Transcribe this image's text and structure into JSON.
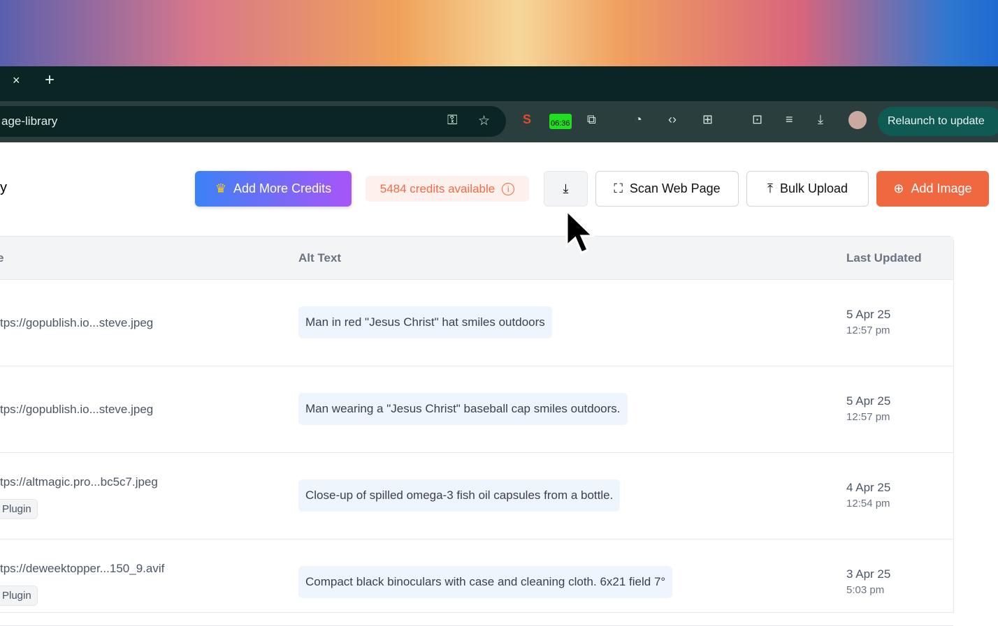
{
  "browser": {
    "tab_close": "×",
    "new_tab": "+",
    "url": "age-library",
    "relaunch": "Relaunch to update",
    "extensions": {
      "seo": "S",
      "clock": "06:36"
    }
  },
  "header": {
    "title_fragment": "y",
    "add_credits": "Add More Credits",
    "credits": "5484 credits available",
    "scan": "Scan Web Page",
    "bulk": "Bulk Upload",
    "add_image": "Add Image"
  },
  "table": {
    "columns": [
      "e",
      "Alt Text",
      "Last Updated"
    ],
    "rows": [
      {
        "url": "tps://gopublish.io...steve.jpeg",
        "tag": "",
        "alt": "Man in red \"Jesus Christ\" hat smiles outdoors",
        "date": "5 Apr 25",
        "time": "12:57 pm"
      },
      {
        "url": "tps://gopublish.io...steve.jpeg",
        "tag": "",
        "alt": "Man wearing a \"Jesus Christ\" baseball cap smiles outdoors.",
        "date": "5 Apr 25",
        "time": "12:57 pm"
      },
      {
        "url": "tps://altmagic.pro...bc5c7.jpeg",
        "tag": "Plugin",
        "alt": "Close-up of spilled omega-3 fish oil capsules from a bottle.",
        "date": "4 Apr 25",
        "time": "12:54 pm"
      },
      {
        "url": "tps://deweektopper...150_9.avif",
        "tag": "Plugin",
        "alt": "Compact black binoculars with case and cleaning cloth. 6x21 field 7°",
        "date": "3 Apr 25",
        "time": "5:03 pm"
      }
    ]
  }
}
